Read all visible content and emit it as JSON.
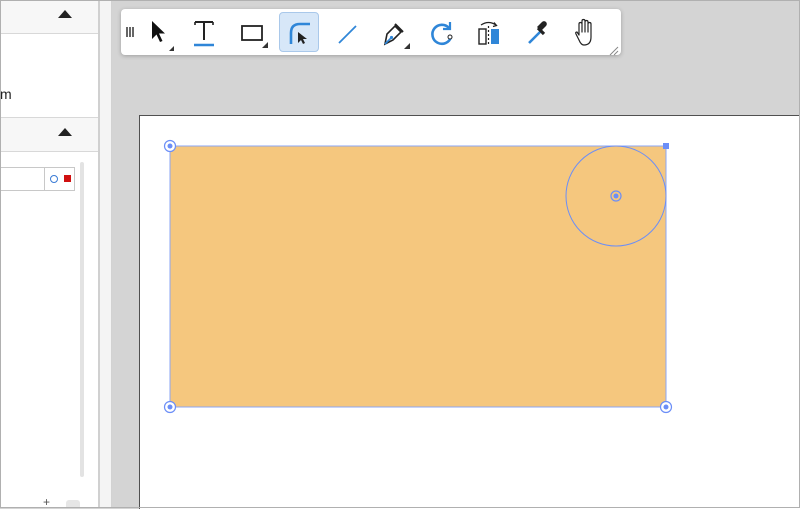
{
  "left_panel": {
    "unit_suffix": "m",
    "add_layer_label": "+"
  },
  "toolbar": {
    "tools": [
      {
        "name": "select",
        "icon": "select-arrow-icon",
        "active": false
      },
      {
        "name": "text",
        "icon": "text-icon",
        "active": false
      },
      {
        "name": "rectangle",
        "icon": "rectangle-icon",
        "active": false
      },
      {
        "name": "edit-path",
        "icon": "path-edit-icon",
        "active": true
      },
      {
        "name": "line",
        "icon": "line-icon",
        "active": false
      },
      {
        "name": "pen",
        "icon": "pen-icon",
        "active": false
      },
      {
        "name": "rotate",
        "icon": "rotate-icon",
        "active": false
      },
      {
        "name": "flip",
        "icon": "flip-icon",
        "active": false
      },
      {
        "name": "eyedropper",
        "icon": "eyedropper-icon",
        "active": false
      },
      {
        "name": "pan",
        "icon": "hand-icon",
        "active": false
      }
    ]
  },
  "colors": {
    "shape_fill": "#f5c77e",
    "selection": "#6b8ef7",
    "active_tool_bg": "#d7e7f8",
    "tool_accent": "#2f86d8",
    "layer_lock": "#d01010"
  }
}
